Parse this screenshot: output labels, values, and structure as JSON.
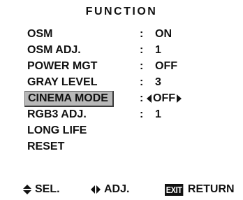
{
  "title": "FUNCTION",
  "menu": {
    "items": [
      {
        "label": "OSM",
        "colon": ":",
        "value": "ON"
      },
      {
        "label": "OSM ADJ.",
        "colon": ":",
        "value": "1"
      },
      {
        "label": "POWER MGT",
        "colon": ":",
        "value": "OFF"
      },
      {
        "label": "GRAY LEVEL",
        "colon": ":",
        "value": "3"
      },
      {
        "label": "CINEMA MODE",
        "colon": ":",
        "value": "OFF",
        "selected": true
      },
      {
        "label": "RGB3 ADJ.",
        "colon": ":",
        "value": "1"
      },
      {
        "label": "LONG LIFE",
        "colon": "",
        "value": ""
      },
      {
        "label": "RESET",
        "colon": "",
        "value": ""
      }
    ]
  },
  "footer": {
    "select": {
      "icon": "up-down-triangles-icon",
      "label": "SEL."
    },
    "adjust": {
      "icon": "left-right-triangles-icon",
      "label": "ADJ."
    },
    "exit": {
      "key": "EXIT",
      "label": "RETURN"
    }
  }
}
